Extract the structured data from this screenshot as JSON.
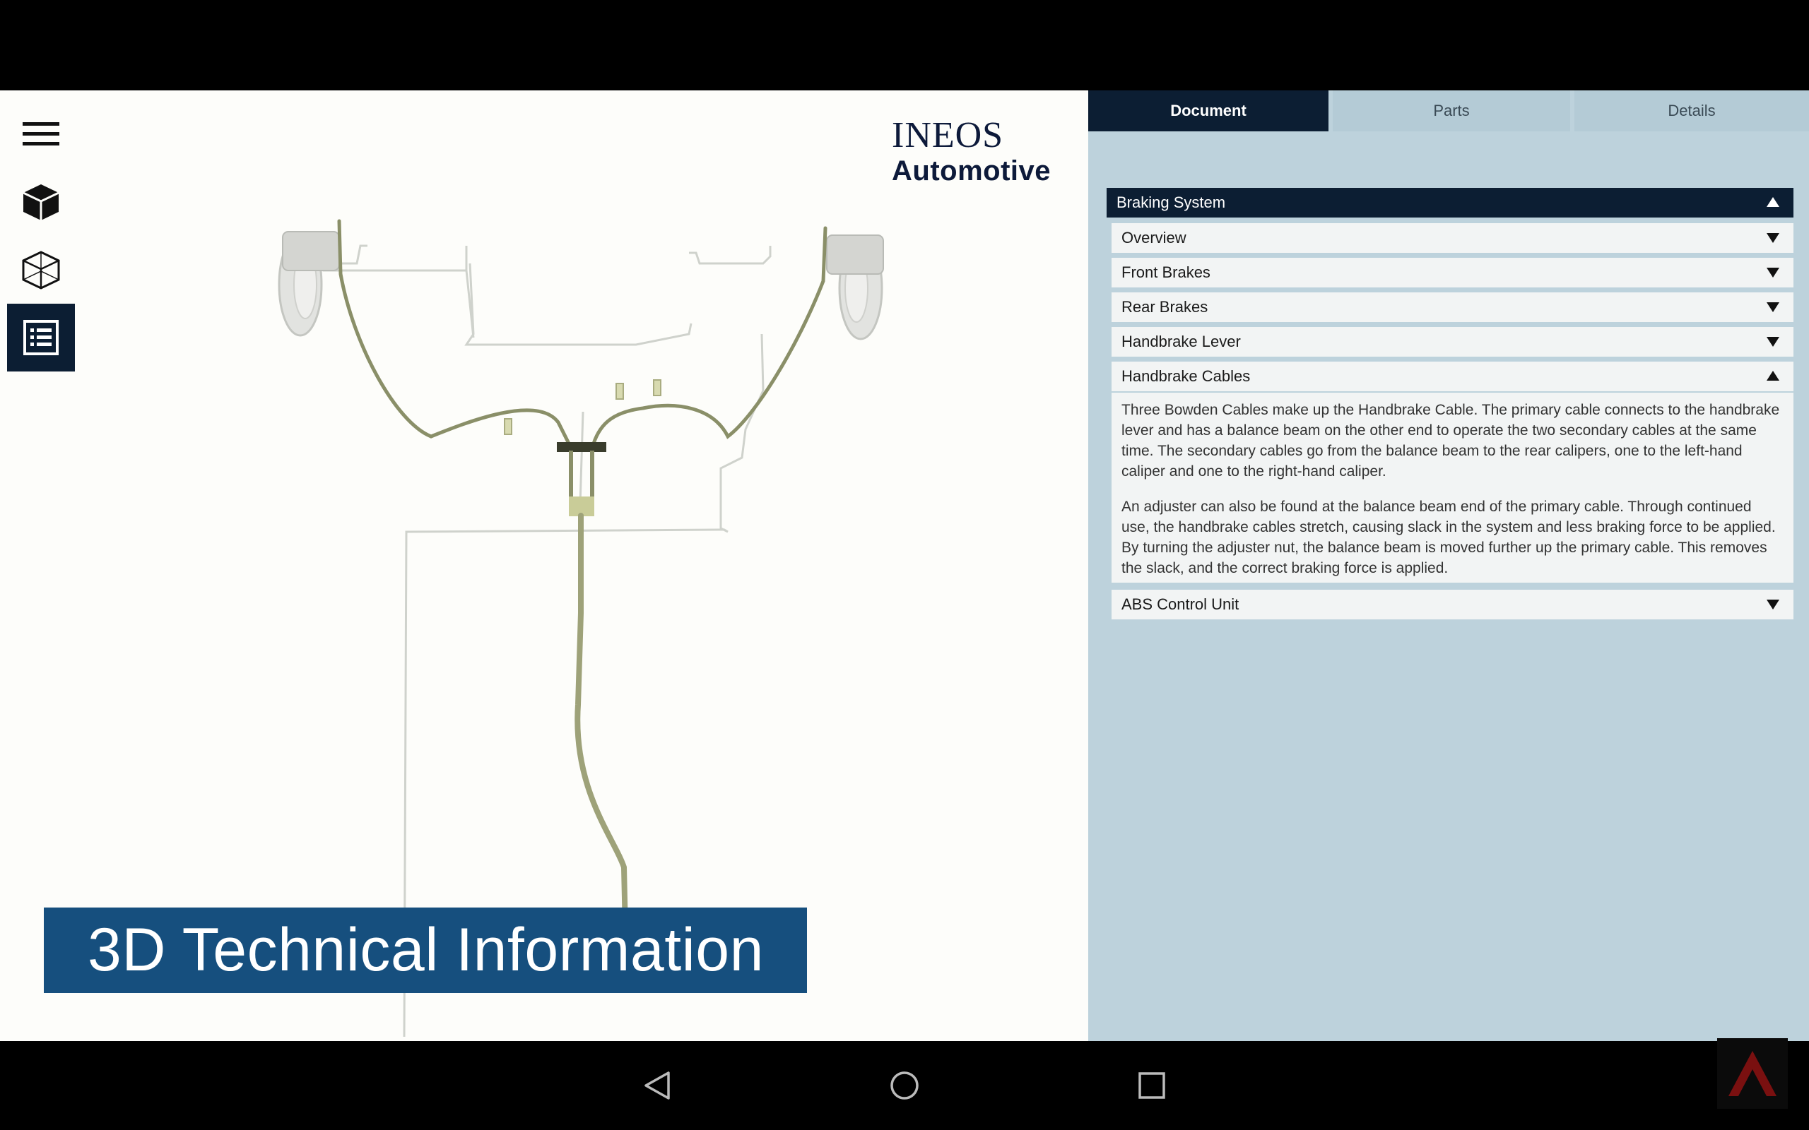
{
  "brand": {
    "line1": "INEOS",
    "line2": "Automotive"
  },
  "toolbar": {
    "items": [
      {
        "icon": "hamburger-menu-icon"
      },
      {
        "icon": "solid-cube-icon"
      },
      {
        "icon": "wireframe-cube-icon"
      },
      {
        "icon": "document-list-icon",
        "active": true
      }
    ]
  },
  "banner": {
    "text": "3D Technical Information"
  },
  "tabs": [
    {
      "label": "Document",
      "active": true
    },
    {
      "label": "Parts"
    },
    {
      "label": "Details"
    }
  ],
  "accordion": {
    "root": "Braking System",
    "items": [
      {
        "label": "Overview"
      },
      {
        "label": "Front Brakes"
      },
      {
        "label": "Rear Brakes"
      },
      {
        "label": "Handbrake Lever"
      },
      {
        "label": "Handbrake Cables",
        "expanded": true
      },
      {
        "label": "ABS Control Unit"
      }
    ],
    "handbrake_cables_body": [
      "Three Bowden Cables make up the Handbrake Cable. The primary cable connects to the handbrake lever and has a balance beam on the other end to operate the two secondary cables at the same time. The secondary cables go from the balance beam to the rear calipers, one to the left-hand caliper and one to the right-hand caliper.",
      "An adjuster can also be found at the balance beam end of the primary cable. Through continued use, the handbrake cables stretch, causing slack in the system and less braking force to be applied. By turning the adjuster nut, the balance beam is moved further up the primary cable. This removes the slack, and the correct braking force is applied."
    ]
  },
  "colors": {
    "navy": "#0c1e33",
    "banner_blue": "#164f7e",
    "panel_bg": "#bdd2dc",
    "cable_olive": "#8a8f68"
  }
}
